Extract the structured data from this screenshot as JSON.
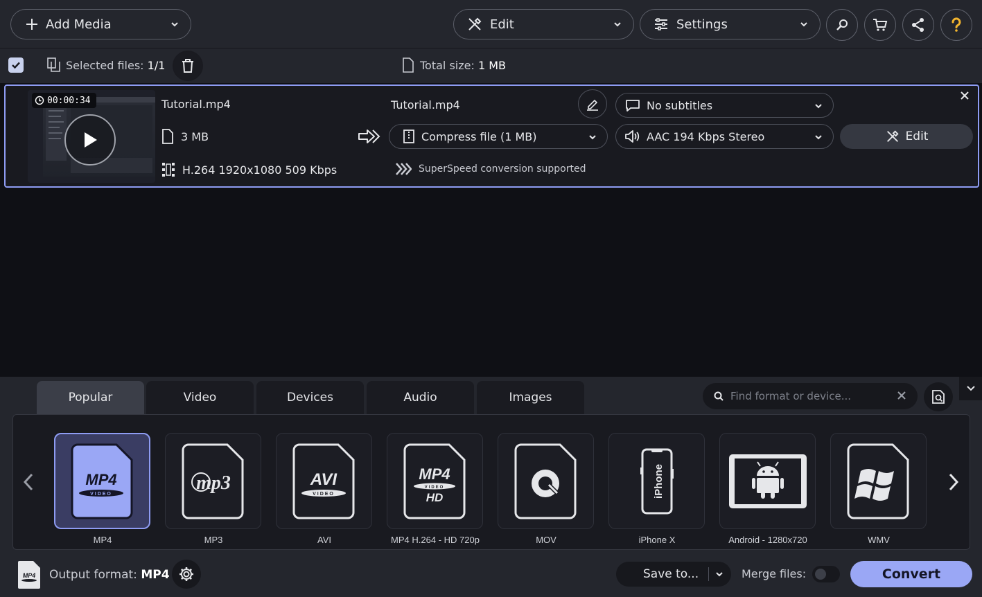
{
  "toolbar": {
    "add_media_label": "Add Media",
    "edit_label": "Edit",
    "settings_label": "Settings"
  },
  "selection": {
    "selected_label": "Selected files:",
    "selected_value": "1/1",
    "total_label": "Total size:",
    "total_value": "1 MB"
  },
  "file": {
    "duration": "00:00:34",
    "source_name": "Tutorial.mp4",
    "source_size": "3 MB",
    "source_codec": "H.264 1920x1080 509 Kbps",
    "output_name": "Tutorial.mp4",
    "compress_label": "Compress file (1 MB)",
    "superspeed_label": "SuperSpeed conversion supported",
    "subtitles_label": "No subtitles",
    "audio_label": "AAC 194 Kbps Stereo",
    "edit_label": "Edit"
  },
  "tabs": [
    {
      "label": "Popular",
      "active": true
    },
    {
      "label": "Video"
    },
    {
      "label": "Devices"
    },
    {
      "label": "Audio"
    },
    {
      "label": "Images"
    }
  ],
  "search": {
    "placeholder": "Find format or device..."
  },
  "formats": [
    {
      "label": "MP4",
      "active": true
    },
    {
      "label": "MP3"
    },
    {
      "label": "AVI"
    },
    {
      "label": "MP4 H.264 - HD 720p"
    },
    {
      "label": "MOV"
    },
    {
      "label": "iPhone X"
    },
    {
      "label": "Android - 1280x720"
    },
    {
      "label": "WMV"
    }
  ],
  "format_icons": {
    "mp4": {
      "big": "MP4",
      "band": "VIDEO"
    },
    "mp3": {
      "text": "mp3"
    },
    "avi": {
      "big": "AVI",
      "band": "VIDEO"
    },
    "mp4hd": {
      "big": "MP4",
      "band": "VIDEO",
      "sub": "HD"
    },
    "iphone": {
      "text": "iPhone"
    }
  },
  "bottom": {
    "output_label": "Output format:",
    "output_value": "MP4",
    "output_icon_text": "MP4",
    "save_to_label": "Save to...",
    "merge_label": "Merge files:",
    "convert_label": "Convert"
  },
  "colors": {
    "accent": "#9aa7f5",
    "selection_border": "#8e9cf3",
    "toolbar_bg": "#24262d",
    "content_bg": "#0f1015"
  }
}
